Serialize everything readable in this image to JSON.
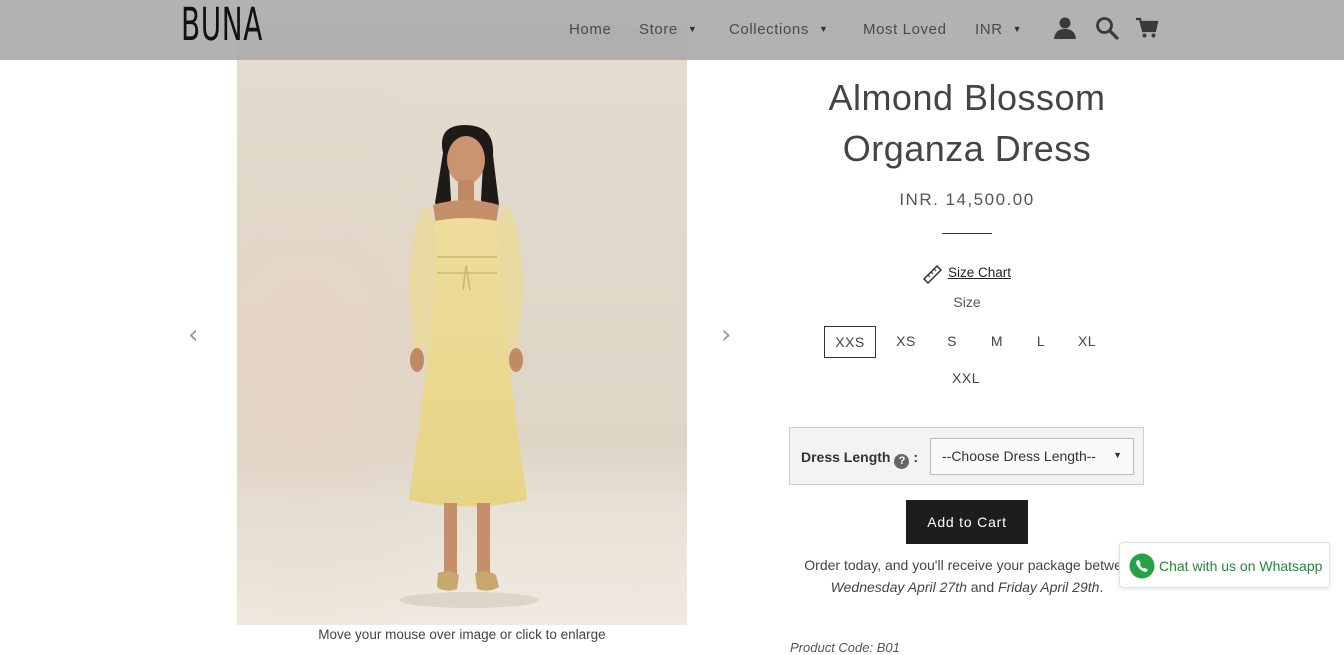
{
  "header": {
    "logo": "BUNA",
    "nav": [
      {
        "label": "Home",
        "has_caret": false
      },
      {
        "label": "Store",
        "has_caret": true
      },
      {
        "label": "Collections",
        "has_caret": true
      },
      {
        "label": "Most Loved",
        "has_caret": false
      },
      {
        "label": "INR",
        "has_caret": true
      }
    ],
    "icons": [
      "account-icon",
      "search-icon",
      "cart-icon"
    ]
  },
  "gallery": {
    "image_alt": "Model wearing a pale yellow organza midi dress with puff sleeves",
    "prev_arrow": "‹",
    "next_arrow": "›",
    "caption": "Move your mouse over image or click to enlarge"
  },
  "product": {
    "title_line1": "Almond Blossom",
    "title_line2": "Organza Dress",
    "price": "INR. 14,500.00",
    "size_chart_label": "Size Chart",
    "size_label": "Size",
    "sizes": [
      "XXS",
      "XS",
      "S",
      "M",
      "L",
      "XL",
      "XXL"
    ],
    "selected_size": "XXS",
    "dress_length_label": "Dress Length",
    "dress_length_help": "?",
    "dress_length_colon": ":",
    "dress_length_value": "--Choose Dress Length--",
    "add_to_cart": "Add to Cart",
    "delivery_prefix": "Order today, and you'll receive your package betwee",
    "delivery_date1": "Wednesday April 27th",
    "delivery_and": "and",
    "delivery_date2": "Friday April 29th",
    "delivery_suffix": ".",
    "product_code": "Product Code: B01"
  },
  "chat": {
    "label": "Chat with us on Whatsapp",
    "icon": "whatsapp-icon"
  },
  "colors": {
    "header_bg": "#aaaaaa",
    "button_bg": "#1d1d1d",
    "whatsapp_green": "#1e8a3a",
    "dress_yellow": "#ecdb93"
  }
}
